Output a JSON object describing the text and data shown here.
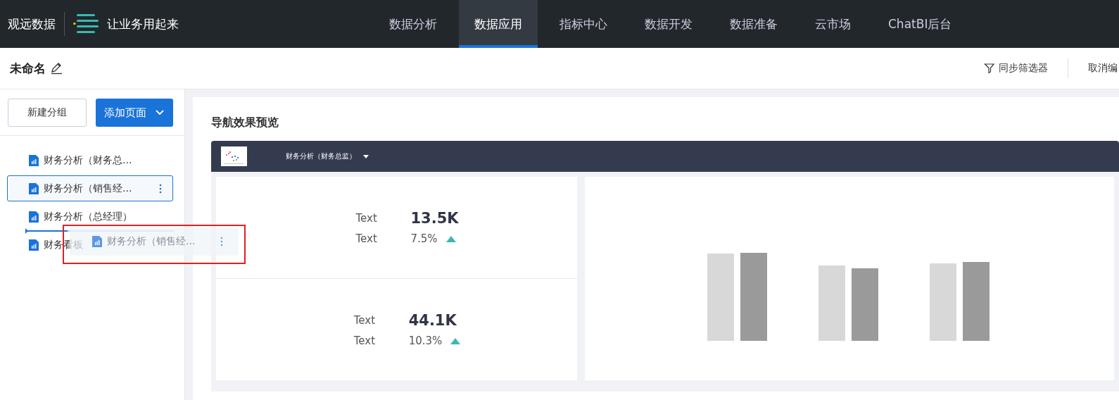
{
  "brand": {
    "name": "观远数据",
    "slogan": "让业务用起来"
  },
  "nav": [
    {
      "label": "数据分析",
      "selected": false
    },
    {
      "label": "数据应用",
      "selected": true
    },
    {
      "label": "指标中心",
      "selected": false
    },
    {
      "label": "数据开发",
      "selected": false
    },
    {
      "label": "数据准备",
      "selected": false
    },
    {
      "label": "云市场",
      "selected": false
    },
    {
      "label": "ChatBI后台",
      "selected": false
    }
  ],
  "page": {
    "title": "未命名",
    "actions": [
      "同步筛选器",
      "取消编"
    ]
  },
  "sidebar": {
    "new_group": "新建分组",
    "add_page": "添加页面",
    "items": [
      {
        "label": "财务分析（财务总...",
        "selected": false
      },
      {
        "label": "财务分析（销售经...",
        "selected": true
      },
      {
        "label": "财务分析（总经理）",
        "selected": false
      },
      {
        "label": "财务看板",
        "selected": false
      }
    ],
    "drag_ghost": {
      "label": "财务分析（销售经..."
    }
  },
  "preview": {
    "title": "导航效果预览",
    "menu": "财务分析（财务总监）",
    "kpis": [
      {
        "label": "Text",
        "value": "13.5K",
        "sub_label": "Text",
        "change": "7.5%"
      },
      {
        "label": "Text",
        "value": "44.1K",
        "sub_label": "Text",
        "change": "10.3%"
      }
    ]
  }
}
